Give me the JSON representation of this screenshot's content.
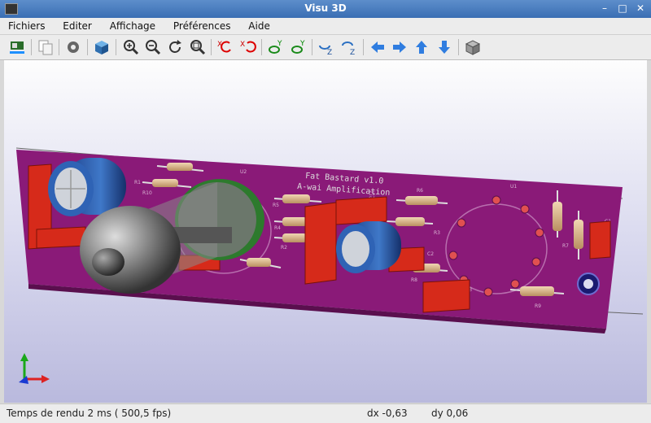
{
  "window": {
    "title": "Visu 3D"
  },
  "menu": [
    "Fichiers",
    "Editer",
    "Affichage",
    "Préférences",
    "Aide"
  ],
  "toolbar": {
    "icons": [
      "reload-board-icon",
      "copy-image-icon",
      "settings-gear-icon",
      "3d-box-icon",
      "zoom-in-icon",
      "zoom-out-icon",
      "redraw-icon",
      "zoom-fit-icon",
      "rotate-x-cw-icon",
      "rotate-x-ccw-icon",
      "rotate-y-cw-icon",
      "rotate-y-ccw-icon",
      "rotate-z-cw-icon",
      "rotate-z-ccw-icon",
      "move-left-icon",
      "move-right-icon",
      "move-up-icon",
      "move-down-icon",
      "ortho-toggle-icon"
    ]
  },
  "board": {
    "silk_title": "Fat Bastard v1.0",
    "silk_subtitle": "A-wai Amplification",
    "refs": [
      "U2",
      "U1",
      "R5",
      "C5",
      "C4",
      "R6",
      "R1",
      "C2",
      "C3",
      "R8",
      "R9",
      "R7",
      "C1",
      "R3",
      "R2",
      "R4",
      "R10"
    ]
  },
  "status": {
    "render_time": "Temps de rendu 2 ms ( 500,5 fps)",
    "dx": "dx -0,63",
    "dy": "dy 0,06"
  },
  "colors": {
    "pcb": "#8a1a78",
    "title_bar": "#4a7ec2",
    "background_top": "#fdfdfd",
    "background_bottom": "#b9b9dd"
  }
}
